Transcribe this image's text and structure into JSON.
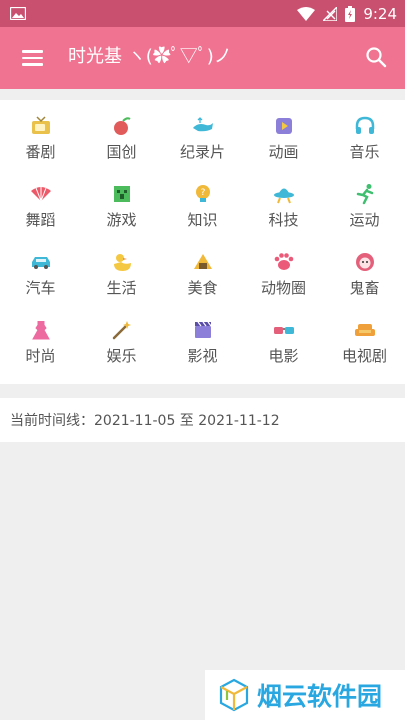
{
  "status_bar": {
    "time": "9:24",
    "battery_icon": "battery-icon",
    "wifi_icon": "wifi-icon",
    "signal_icon": "signal-icon",
    "image_icon": "image-icon"
  },
  "app_bar": {
    "title": "时光基 ヽ(✿ﾟ▽ﾟ)ノ",
    "menu_icon": "menu-icon",
    "search_icon": "search-icon"
  },
  "categories": [
    {
      "label": "番剧",
      "icon": "tv-icon",
      "color": "#e9c14b"
    },
    {
      "label": "国创",
      "icon": "fruit-icon",
      "color": "#e25b5b"
    },
    {
      "label": "纪录片",
      "icon": "whale-icon",
      "color": "#3fb8d8"
    },
    {
      "label": "动画",
      "icon": "play-icon",
      "color": "#8c7fd9"
    },
    {
      "label": "音乐",
      "icon": "headphones-icon",
      "color": "#3fb8d8"
    },
    {
      "label": "舞蹈",
      "icon": "fan-icon",
      "color": "#ec5a6a"
    },
    {
      "label": "游戏",
      "icon": "creeper-icon",
      "color": "#4cbb5c"
    },
    {
      "label": "知识",
      "icon": "lightbulb-icon",
      "color": "#f0b93a"
    },
    {
      "label": "科技",
      "icon": "ufo-icon",
      "color": "#3fb8d8"
    },
    {
      "label": "运动",
      "icon": "runner-icon",
      "color": "#3fbf6f"
    },
    {
      "label": "汽车",
      "icon": "car-icon",
      "color": "#3fb8d8"
    },
    {
      "label": "生活",
      "icon": "duck-icon",
      "color": "#f5c842"
    },
    {
      "label": "美食",
      "icon": "rice-ball-icon",
      "color": "#f0b93a"
    },
    {
      "label": "动物圈",
      "icon": "paw-icon",
      "color": "#ec5a7a"
    },
    {
      "label": "鬼畜",
      "icon": "monster-icon",
      "color": "#e4607a"
    },
    {
      "label": "时尚",
      "icon": "dress-icon",
      "color": "#ec6aa0"
    },
    {
      "label": "娱乐",
      "icon": "magic-wand-icon",
      "color": "#f0b93a"
    },
    {
      "label": "影视",
      "icon": "clapperboard-icon",
      "color": "#8c7fd9"
    },
    {
      "label": "电影",
      "icon": "3d-glasses-icon",
      "color": "#e4607a"
    },
    {
      "label": "电视剧",
      "icon": "sofa-icon",
      "color": "#f0a03a"
    }
  ],
  "timeline": {
    "text": "当前时间线：2021-11-05 至 2021-11-12"
  },
  "watermark": {
    "text": "烟云软件园",
    "icon": "cube-logo-icon"
  },
  "colors": {
    "status_bar": "#c9506f",
    "app_bar": "#f07391",
    "background": "#efefef"
  }
}
